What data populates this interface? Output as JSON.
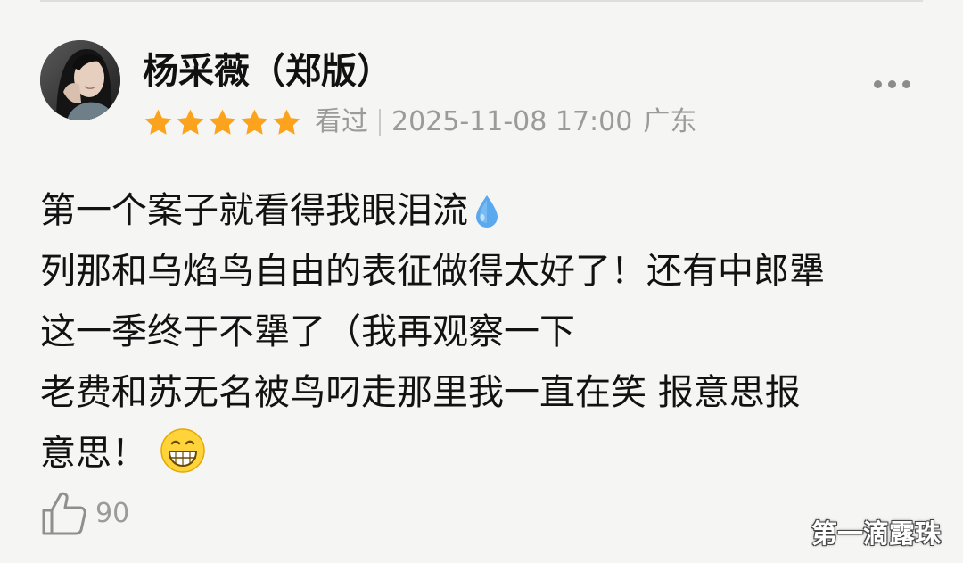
{
  "comment": {
    "username": "杨采薇（郑版）",
    "rating_stars": 5,
    "status": "看过",
    "timestamp": "2025-11-08 17:00",
    "location": "广东",
    "text_lines": [
      "第一个案子就看得我眼泪流",
      "列那和乌焰鸟自由的表征做得太好了！还有中郎犟",
      "这一季终于不犟了（我再观察一下",
      "老费和苏无名被鸟叼走那里我一直在笑  报意思报",
      "意思！"
    ],
    "emojis": [
      "droplet-icon",
      "grinning-face-icon"
    ],
    "likes": "90"
  },
  "watermark": "第一滴露珠",
  "colors": {
    "background": "#f5f5f4",
    "star": "#fca31d",
    "meta_gray": "#9b9b9b",
    "droplet": "#5aa9ee",
    "emoji_face": "#ffd43b"
  }
}
